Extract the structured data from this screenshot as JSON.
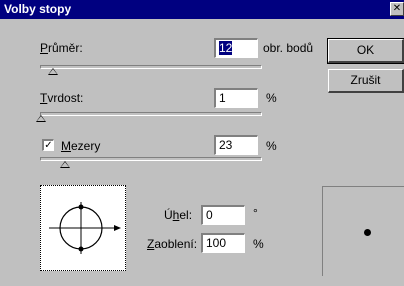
{
  "window": {
    "title": "Volby stopy"
  },
  "diameter": {
    "label_accel": "P",
    "label_rest": "růměr:",
    "value": "12",
    "unit": "obr. bodů",
    "slider_fraction": 0.06
  },
  "hardness": {
    "label_accel": "T",
    "label_rest": "vrdost:",
    "value": "1",
    "unit": "%",
    "slider_fraction": 0.01
  },
  "spacing": {
    "checked": true,
    "check_mark": "✓",
    "label_accel": "M",
    "label_rest": "ezery",
    "value": "23",
    "unit": "%",
    "slider_fraction": 0.12
  },
  "angle": {
    "label_pre": "Ú",
    "label_accel": "h",
    "label_post": "el:",
    "value": "0",
    "unit": "°"
  },
  "roundness": {
    "label_accel": "Z",
    "label_rest": "aoblení:",
    "value": "100",
    "unit": "%"
  },
  "buttons": {
    "ok": "OK",
    "cancel": "Zrušit"
  },
  "close_glyph": "✕"
}
